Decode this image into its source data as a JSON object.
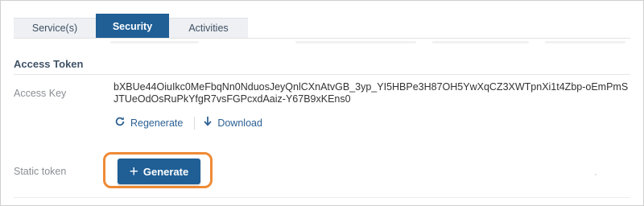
{
  "tabs": [
    {
      "label": "Service(s)",
      "active": false
    },
    {
      "label": "Security",
      "active": true
    },
    {
      "label": "Activities",
      "active": false
    }
  ],
  "section": {
    "title": "Access Token"
  },
  "access_key": {
    "label": "Access Key",
    "value": "bXBUe44OiuIkc0MeFbqNn0NduosJeyQnlCXnAtvGB_3yp_YI5HBPe3H87OH5YwXqCZ3XWTpnXi1t4Zbp-oEmPmSJTUeOdOsRuPkYfgR7vsFGPcxdAaiz-Y67B9xKEns0"
  },
  "actions": {
    "regenerate_label": "Regenerate",
    "download_label": "Download"
  },
  "static_token": {
    "label": "Static token",
    "generate_label": "Generate"
  },
  "icons": {
    "regenerate": "refresh-icon",
    "download": "download-icon",
    "generate": "plus-icon"
  },
  "colors": {
    "primary": "#1f5f96",
    "highlight": "#ef8a36",
    "link": "#2a5f93"
  }
}
